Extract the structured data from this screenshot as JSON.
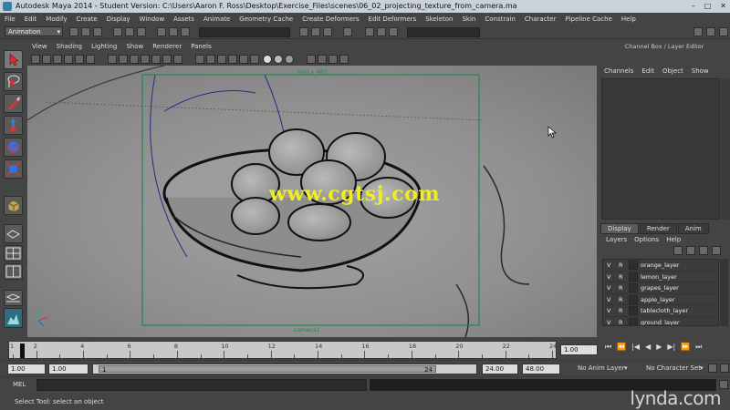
{
  "titlebar": {
    "title": "Autodesk Maya 2014 - Student Version: C:\\Users\\Aaron F. Ross\\Desktop\\Exercise_Files\\scenes\\06_02_projecting_texture_from_camera.ma",
    "minimize": "–",
    "maximize": "□",
    "close": "✕"
  },
  "menubar": [
    "File",
    "Edit",
    "Modify",
    "Create",
    "Display",
    "Window",
    "Assets",
    "Animate",
    "Geometry Cache",
    "Create Deformers",
    "Edit Deformers",
    "Skeleton",
    "Skin",
    "Constrain",
    "Character",
    "Pipeline Cache",
    "Help"
  ],
  "statusline": {
    "mode": "Animation"
  },
  "panel": {
    "menu": [
      "View",
      "Shading",
      "Lighting",
      "Show",
      "Renderer",
      "Panels"
    ],
    "resolution_gate": "640 x 480",
    "camera_name": "camera1"
  },
  "watermark_text": "www.cgtsj.com",
  "channel_box": {
    "title": "Channel Box / Layer Editor",
    "menu": [
      "Channels",
      "Edit",
      "Object",
      "Show"
    ]
  },
  "layer_editor": {
    "tabs": [
      "Display",
      "Render",
      "Anim"
    ],
    "active_tab": "Display",
    "menu": [
      "Layers",
      "Options",
      "Help"
    ],
    "layers": [
      {
        "v": "V",
        "r": "R",
        "name": "orange_layer"
      },
      {
        "v": "V",
        "r": "R",
        "name": "lemon_layer"
      },
      {
        "v": "V",
        "r": "R",
        "name": "grapes_layer"
      },
      {
        "v": "V",
        "r": "R",
        "name": "apple_layer"
      },
      {
        "v": "V",
        "r": "R",
        "name": "tablecloth_layer"
      },
      {
        "v": "V",
        "r": "R",
        "name": "ground_layer"
      }
    ]
  },
  "time_slider": {
    "tick_labels": [
      "1",
      "2",
      "4",
      "6",
      "8",
      "10",
      "12",
      "14",
      "16",
      "18",
      "20",
      "22",
      "24"
    ],
    "current_frame": "1.00",
    "playback": [
      "⏮",
      "⏪",
      "|◀",
      "◀",
      "▶",
      "▶|",
      "⏩",
      "⏭"
    ]
  },
  "range_slider": {
    "start": "1.00",
    "current": "1.00",
    "range_start_label": "1",
    "range_end_label": "24",
    "playback_end": "24.00",
    "end": "48.00",
    "anim_layer": "No Anim Layer",
    "character_set": "No Character Set"
  },
  "command_line": {
    "label": "MEL"
  },
  "help_line": {
    "text": "Select Tool: select an object"
  },
  "brand": "lynda.com",
  "colors": {
    "gate": "#1e8a4a",
    "curve": "#1d2f86",
    "watermark": "#f0ee1c"
  }
}
